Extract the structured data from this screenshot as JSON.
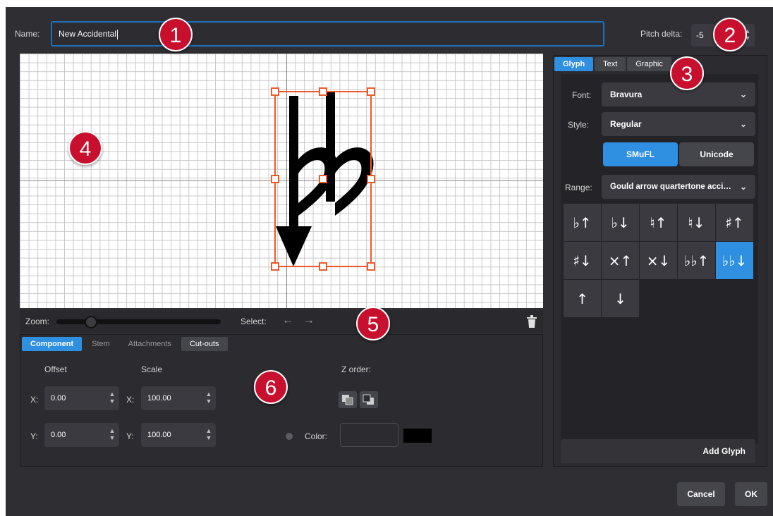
{
  "header": {
    "name_label": "Name:",
    "name_value": "New Accidental",
    "pitch_label": "Pitch delta:",
    "pitch_value": "-5"
  },
  "canvas": {
    "glyph": "flat-flat-arrow-down-glyph"
  },
  "zoombar": {
    "zoom_label": "Zoom:",
    "select_label": "Select:",
    "prev_symbol": "←",
    "next_symbol": "→"
  },
  "bottom": {
    "tabs": [
      "Component",
      "Stem",
      "Attachments",
      "Cut-outs"
    ],
    "offset_label": "Offset",
    "scale_label": "Scale",
    "zorder_label": "Z order:",
    "x_label": "X:",
    "y_label": "Y:",
    "offset_x": "0.00",
    "offset_y": "0.00",
    "scale_x": "100.00",
    "scale_y": "100.00",
    "color_label": "Color:",
    "color_value": "#000000"
  },
  "right": {
    "tabs": [
      "Glyph",
      "Text",
      "Graphic"
    ],
    "font_label": "Font:",
    "font_value": "Bravura",
    "style_label": "Style:",
    "style_value": "Regular",
    "encoding_options": [
      "SMuFL",
      "Unicode"
    ],
    "range_label": "Range:",
    "range_value": "Gould arrow quartertone acci…",
    "glyphs": [
      "♭↑",
      "♭↓",
      "♮↑",
      "♮↓",
      "♯↑",
      "♯↓",
      "×↑",
      "×↓",
      "♭♭↑",
      "♭♭↓",
      "↑",
      "↓"
    ],
    "add_glyph_label": "Add Glyph"
  },
  "footer": {
    "cancel_label": "Cancel",
    "ok_label": "OK"
  },
  "callouts": [
    "1",
    "2",
    "3",
    "4",
    "5",
    "6"
  ],
  "colors": {
    "accent": "#2f8fe0",
    "selection_handles": "#f05a28",
    "callout": "#c8102e"
  }
}
